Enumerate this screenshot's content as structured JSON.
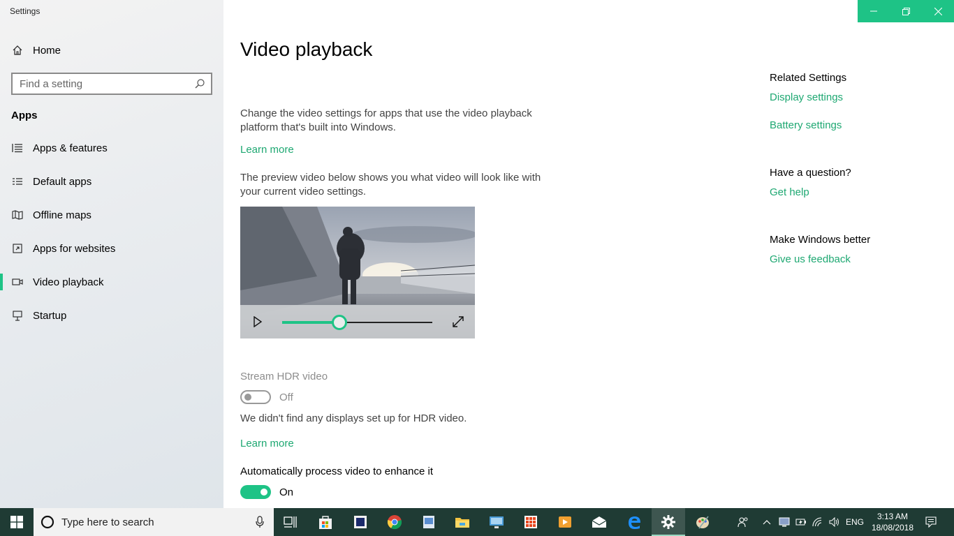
{
  "window": {
    "title": "Settings"
  },
  "sidebar": {
    "home_label": "Home",
    "search_placeholder": "Find a setting",
    "section_title": "Apps",
    "items": [
      {
        "label": "Apps & features",
        "icon": "list-icon"
      },
      {
        "label": "Default apps",
        "icon": "default-apps-icon"
      },
      {
        "label": "Offline maps",
        "icon": "map-icon"
      },
      {
        "label": "Apps for websites",
        "icon": "website-icon"
      },
      {
        "label": "Video playback",
        "icon": "video-icon",
        "selected": true
      },
      {
        "label": "Startup",
        "icon": "startup-icon"
      }
    ]
  },
  "main": {
    "title": "Video playback",
    "intro": "Change the video settings for apps that use the video playback platform that's built into Windows.",
    "learn_more_1": "Learn more",
    "preview_text": "The preview video below shows you what video will look like with your current video settings.",
    "video": {
      "progress": 0.38
    },
    "hdr": {
      "title": "Stream HDR video",
      "state": "Off",
      "on": false,
      "note": "We didn't find any displays set up for HDR video.",
      "learn_more": "Learn more"
    },
    "auto_process": {
      "title": "Automatically process video to enhance it",
      "state": "On",
      "on": true
    }
  },
  "related": {
    "heading": "Related Settings",
    "links": [
      "Display settings",
      "Battery settings"
    ],
    "question_heading": "Have a question?",
    "help_link": "Get help",
    "better_heading": "Make Windows better",
    "feedback_link": "Give us feedback"
  },
  "taskbar": {
    "search_placeholder": "Type here to search",
    "language": "ENG",
    "time": "3:13 AM",
    "date": "18/08/2018"
  },
  "colors": {
    "accent": "#1ec386",
    "link": "#1ea872",
    "taskbar": "#1f3b34"
  }
}
